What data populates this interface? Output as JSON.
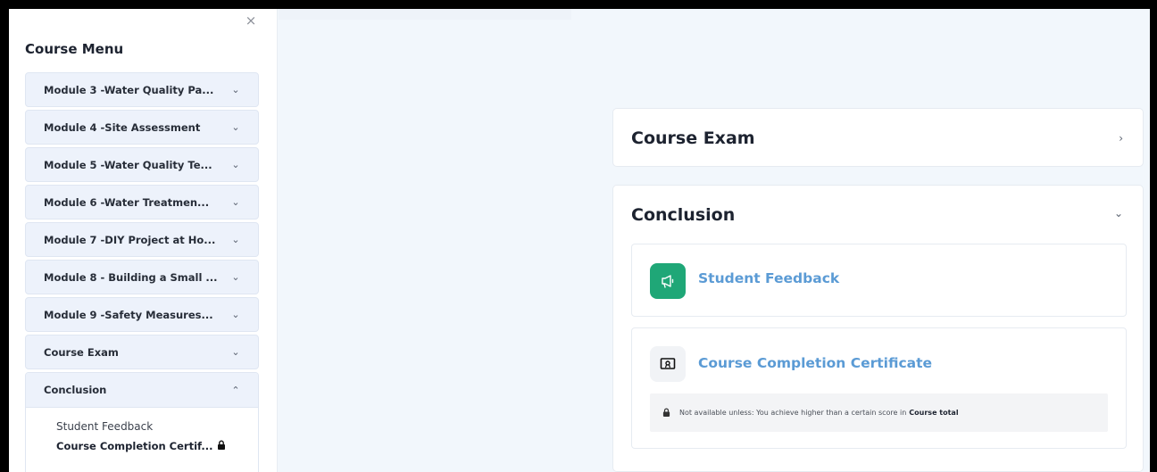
{
  "sidebar": {
    "close": "×",
    "title": "Course Menu",
    "items": [
      {
        "label": "Module 3 -Water Quality Pa...",
        "chevron": "v"
      },
      {
        "label": "Module 4 -Site Assessment",
        "chevron": "v"
      },
      {
        "label": "Module 5 -Water Quality Te...",
        "chevron": "v"
      },
      {
        "label": "Module 6 -Water Treatmen...",
        "chevron": "v"
      },
      {
        "label": "Module 7 -DIY Project at Ho...",
        "chevron": "v"
      },
      {
        "label": "Module 8 - Building a Small ...",
        "chevron": "v"
      },
      {
        "label": "Module 9 -Safety Measures...",
        "chevron": "v"
      },
      {
        "label": "Course Exam",
        "chevron": "v"
      }
    ],
    "conclusion": {
      "label": "Conclusion",
      "chevron": "^",
      "sub_items": [
        "Student Feedback",
        "Course Completion Certif..."
      ]
    }
  },
  "main": {
    "exam": {
      "title": "Course Exam",
      "chevron": "›"
    },
    "conclusion": {
      "title": "Conclusion",
      "chevron": "v",
      "activities": [
        {
          "name": "Student Feedback",
          "icon": "megaphone-icon"
        },
        {
          "name": "Course Completion Certificate",
          "icon": "certificate-icon"
        }
      ],
      "restriction": {
        "text": "Not available unless: You achieve higher than a certain score in",
        "bold": "Course total"
      }
    }
  },
  "colors": {
    "accent_link": "#5b9bd5",
    "feedback_icon_bg": "#1fa777",
    "menu_item_bg": "#edf2fb",
    "page_bg": "#f2f7fc"
  }
}
